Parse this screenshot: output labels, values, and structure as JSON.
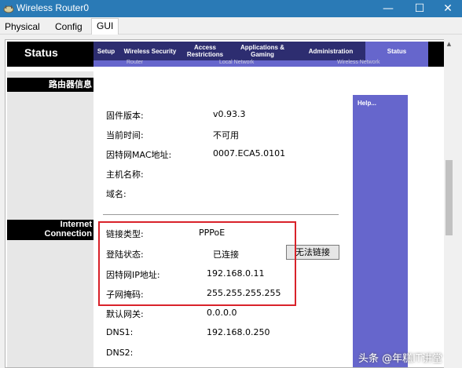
{
  "window": {
    "title": "Wireless Router0"
  },
  "tabs": [
    {
      "label": "Physical"
    },
    {
      "label": "Config"
    },
    {
      "label": "GUI"
    }
  ],
  "router_header": {
    "section_title": "Status",
    "menu": [
      {
        "label": "Setup"
      },
      {
        "label": "Wireless Security"
      },
      {
        "label": "Access Restrictions"
      },
      {
        "label": "Applications & Gaming"
      },
      {
        "label": "Administration"
      }
    ],
    "active_menu": "Status",
    "submenu": [
      {
        "label": "Router"
      },
      {
        "label": "Local Network"
      },
      {
        "label": "Wireless Network"
      }
    ]
  },
  "left_sections": [
    {
      "label": "路由器信息"
    },
    {
      "label": "Internet"
    },
    {
      "label": "Connection"
    }
  ],
  "router_info": [
    {
      "label": "固件版本:",
      "value": "v0.93.3"
    },
    {
      "label": "当前时间:",
      "value": "不可用"
    },
    {
      "label": "因特网MAC地址:",
      "value": "0007.ECA5.0101"
    },
    {
      "label": "主机名称:",
      "value": ""
    },
    {
      "label": "域名:",
      "value": ""
    }
  ],
  "internet_connection": [
    {
      "label": "链接类型:",
      "value": "PPPoE"
    },
    {
      "label": "登陆状态:",
      "value": "已连接"
    },
    {
      "label": "因特网IP地址:",
      "value": "192.168.0.11"
    },
    {
      "label": "子网掩码:",
      "value": "255.255.255.255"
    },
    {
      "label": "默认网关:",
      "value": "0.0.0.0"
    },
    {
      "label": "DNS1:",
      "value": "192.168.0.250"
    },
    {
      "label": "DNS2:",
      "value": ""
    }
  ],
  "release_button": {
    "label": "无法链接"
  },
  "help": {
    "label": "Help..."
  },
  "watermark": {
    "text": "头条 @年糕IT讲堂"
  },
  "colors": {
    "titlebar": "#2a7ab6",
    "menu_bar": "#2d2d70",
    "accent": "#6666cc",
    "highlight": "#d9222a"
  }
}
